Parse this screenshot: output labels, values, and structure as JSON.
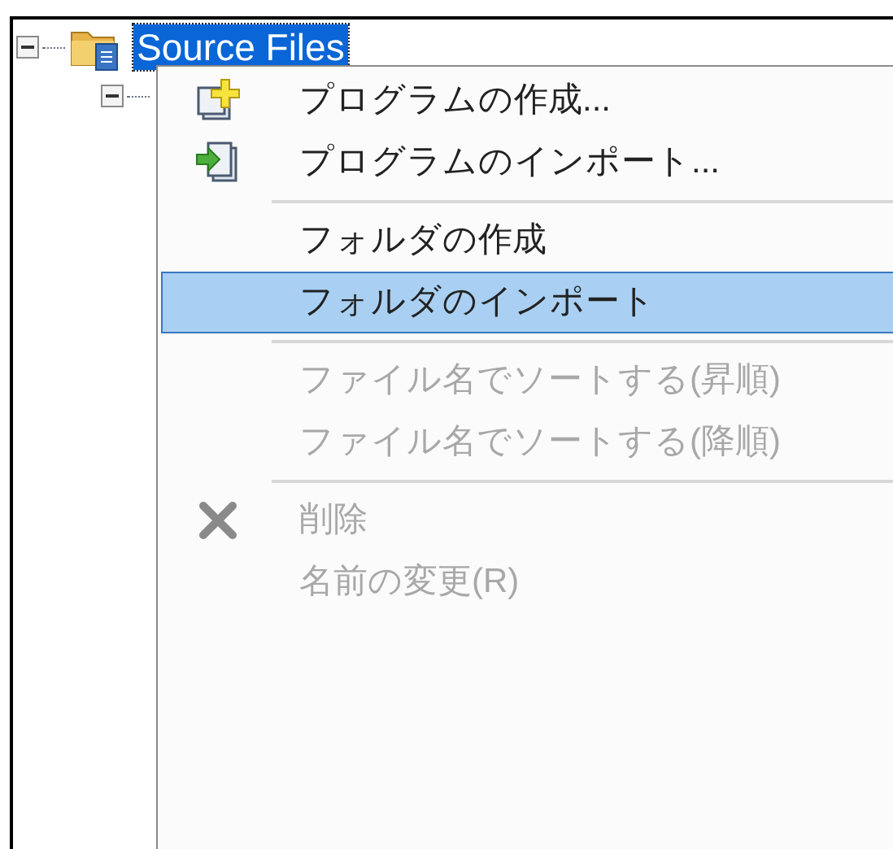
{
  "tree": {
    "root": {
      "label": "Source Files",
      "selected": true,
      "expanded": true
    },
    "child": {
      "expanded": true
    }
  },
  "context_menu": {
    "items": [
      {
        "kind": "create",
        "label": "プログラムの作成...",
        "disabled": false,
        "selected": false
      },
      {
        "kind": "import",
        "label": "プログラムのインポート...",
        "disabled": false,
        "selected": false
      },
      {
        "kind": "separator"
      },
      {
        "kind": "item",
        "label": "フォルダの作成",
        "disabled": false,
        "selected": false
      },
      {
        "kind": "item",
        "label": "フォルダのインポート",
        "disabled": false,
        "selected": true
      },
      {
        "kind": "separator"
      },
      {
        "kind": "item",
        "label": "ファイル名でソートする(昇順)",
        "disabled": true,
        "selected": false
      },
      {
        "kind": "item",
        "label": "ファイル名でソートする(降順)",
        "disabled": true,
        "selected": false
      },
      {
        "kind": "separator"
      },
      {
        "kind": "delete",
        "label": "削除",
        "disabled": true,
        "selected": false
      },
      {
        "kind": "item",
        "label": "名前の変更(R)",
        "disabled": true,
        "selected": false
      }
    ]
  }
}
